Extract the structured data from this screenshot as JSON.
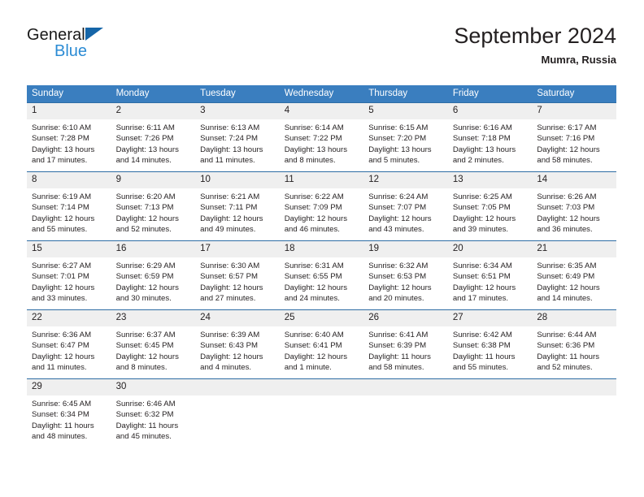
{
  "brand": {
    "name_part1": "General",
    "name_part2": "Blue",
    "triangle_icon": "triangle-icon",
    "accent_blue": "#2b8bd4",
    "logo_triangle_color": "#1565a8"
  },
  "header": {
    "title": "September 2024",
    "subtitle": "Mumra, Russia"
  },
  "theme": {
    "header_row_bg": "#3a7ebf",
    "row_rule": "#2e6da4",
    "daynum_bg": "#efefef",
    "text": "#231f20"
  },
  "calendar": {
    "weekday_headers": [
      "Sunday",
      "Monday",
      "Tuesday",
      "Wednesday",
      "Thursday",
      "Friday",
      "Saturday"
    ],
    "labels": {
      "sunrise": "Sunrise:",
      "sunset": "Sunset:",
      "daylight": "Daylight:"
    },
    "weeks": [
      [
        {
          "day": "1",
          "sunrise": "Sunrise: 6:10 AM",
          "sunset": "Sunset: 7:28 PM",
          "daylight_l1": "Daylight: 13 hours",
          "daylight_l2": "and 17 minutes."
        },
        {
          "day": "2",
          "sunrise": "Sunrise: 6:11 AM",
          "sunset": "Sunset: 7:26 PM",
          "daylight_l1": "Daylight: 13 hours",
          "daylight_l2": "and 14 minutes."
        },
        {
          "day": "3",
          "sunrise": "Sunrise: 6:13 AM",
          "sunset": "Sunset: 7:24 PM",
          "daylight_l1": "Daylight: 13 hours",
          "daylight_l2": "and 11 minutes."
        },
        {
          "day": "4",
          "sunrise": "Sunrise: 6:14 AM",
          "sunset": "Sunset: 7:22 PM",
          "daylight_l1": "Daylight: 13 hours",
          "daylight_l2": "and 8 minutes."
        },
        {
          "day": "5",
          "sunrise": "Sunrise: 6:15 AM",
          "sunset": "Sunset: 7:20 PM",
          "daylight_l1": "Daylight: 13 hours",
          "daylight_l2": "and 5 minutes."
        },
        {
          "day": "6",
          "sunrise": "Sunrise: 6:16 AM",
          "sunset": "Sunset: 7:18 PM",
          "daylight_l1": "Daylight: 13 hours",
          "daylight_l2": "and 2 minutes."
        },
        {
          "day": "7",
          "sunrise": "Sunrise: 6:17 AM",
          "sunset": "Sunset: 7:16 PM",
          "daylight_l1": "Daylight: 12 hours",
          "daylight_l2": "and 58 minutes."
        }
      ],
      [
        {
          "day": "8",
          "sunrise": "Sunrise: 6:19 AM",
          "sunset": "Sunset: 7:14 PM",
          "daylight_l1": "Daylight: 12 hours",
          "daylight_l2": "and 55 minutes."
        },
        {
          "day": "9",
          "sunrise": "Sunrise: 6:20 AM",
          "sunset": "Sunset: 7:13 PM",
          "daylight_l1": "Daylight: 12 hours",
          "daylight_l2": "and 52 minutes."
        },
        {
          "day": "10",
          "sunrise": "Sunrise: 6:21 AM",
          "sunset": "Sunset: 7:11 PM",
          "daylight_l1": "Daylight: 12 hours",
          "daylight_l2": "and 49 minutes."
        },
        {
          "day": "11",
          "sunrise": "Sunrise: 6:22 AM",
          "sunset": "Sunset: 7:09 PM",
          "daylight_l1": "Daylight: 12 hours",
          "daylight_l2": "and 46 minutes."
        },
        {
          "day": "12",
          "sunrise": "Sunrise: 6:24 AM",
          "sunset": "Sunset: 7:07 PM",
          "daylight_l1": "Daylight: 12 hours",
          "daylight_l2": "and 43 minutes."
        },
        {
          "day": "13",
          "sunrise": "Sunrise: 6:25 AM",
          "sunset": "Sunset: 7:05 PM",
          "daylight_l1": "Daylight: 12 hours",
          "daylight_l2": "and 39 minutes."
        },
        {
          "day": "14",
          "sunrise": "Sunrise: 6:26 AM",
          "sunset": "Sunset: 7:03 PM",
          "daylight_l1": "Daylight: 12 hours",
          "daylight_l2": "and 36 minutes."
        }
      ],
      [
        {
          "day": "15",
          "sunrise": "Sunrise: 6:27 AM",
          "sunset": "Sunset: 7:01 PM",
          "daylight_l1": "Daylight: 12 hours",
          "daylight_l2": "and 33 minutes."
        },
        {
          "day": "16",
          "sunrise": "Sunrise: 6:29 AM",
          "sunset": "Sunset: 6:59 PM",
          "daylight_l1": "Daylight: 12 hours",
          "daylight_l2": "and 30 minutes."
        },
        {
          "day": "17",
          "sunrise": "Sunrise: 6:30 AM",
          "sunset": "Sunset: 6:57 PM",
          "daylight_l1": "Daylight: 12 hours",
          "daylight_l2": "and 27 minutes."
        },
        {
          "day": "18",
          "sunrise": "Sunrise: 6:31 AM",
          "sunset": "Sunset: 6:55 PM",
          "daylight_l1": "Daylight: 12 hours",
          "daylight_l2": "and 24 minutes."
        },
        {
          "day": "19",
          "sunrise": "Sunrise: 6:32 AM",
          "sunset": "Sunset: 6:53 PM",
          "daylight_l1": "Daylight: 12 hours",
          "daylight_l2": "and 20 minutes."
        },
        {
          "day": "20",
          "sunrise": "Sunrise: 6:34 AM",
          "sunset": "Sunset: 6:51 PM",
          "daylight_l1": "Daylight: 12 hours",
          "daylight_l2": "and 17 minutes."
        },
        {
          "day": "21",
          "sunrise": "Sunrise: 6:35 AM",
          "sunset": "Sunset: 6:49 PM",
          "daylight_l1": "Daylight: 12 hours",
          "daylight_l2": "and 14 minutes."
        }
      ],
      [
        {
          "day": "22",
          "sunrise": "Sunrise: 6:36 AM",
          "sunset": "Sunset: 6:47 PM",
          "daylight_l1": "Daylight: 12 hours",
          "daylight_l2": "and 11 minutes."
        },
        {
          "day": "23",
          "sunrise": "Sunrise: 6:37 AM",
          "sunset": "Sunset: 6:45 PM",
          "daylight_l1": "Daylight: 12 hours",
          "daylight_l2": "and 8 minutes."
        },
        {
          "day": "24",
          "sunrise": "Sunrise: 6:39 AM",
          "sunset": "Sunset: 6:43 PM",
          "daylight_l1": "Daylight: 12 hours",
          "daylight_l2": "and 4 minutes."
        },
        {
          "day": "25",
          "sunrise": "Sunrise: 6:40 AM",
          "sunset": "Sunset: 6:41 PM",
          "daylight_l1": "Daylight: 12 hours",
          "daylight_l2": "and 1 minute."
        },
        {
          "day": "26",
          "sunrise": "Sunrise: 6:41 AM",
          "sunset": "Sunset: 6:39 PM",
          "daylight_l1": "Daylight: 11 hours",
          "daylight_l2": "and 58 minutes."
        },
        {
          "day": "27",
          "sunrise": "Sunrise: 6:42 AM",
          "sunset": "Sunset: 6:38 PM",
          "daylight_l1": "Daylight: 11 hours",
          "daylight_l2": "and 55 minutes."
        },
        {
          "day": "28",
          "sunrise": "Sunrise: 6:44 AM",
          "sunset": "Sunset: 6:36 PM",
          "daylight_l1": "Daylight: 11 hours",
          "daylight_l2": "and 52 minutes."
        }
      ],
      [
        {
          "day": "29",
          "sunrise": "Sunrise: 6:45 AM",
          "sunset": "Sunset: 6:34 PM",
          "daylight_l1": "Daylight: 11 hours",
          "daylight_l2": "and 48 minutes."
        },
        {
          "day": "30",
          "sunrise": "Sunrise: 6:46 AM",
          "sunset": "Sunset: 6:32 PM",
          "daylight_l1": "Daylight: 11 hours",
          "daylight_l2": "and 45 minutes."
        },
        {
          "day": "",
          "sunrise": "",
          "sunset": "",
          "daylight_l1": "",
          "daylight_l2": ""
        },
        {
          "day": "",
          "sunrise": "",
          "sunset": "",
          "daylight_l1": "",
          "daylight_l2": ""
        },
        {
          "day": "",
          "sunrise": "",
          "sunset": "",
          "daylight_l1": "",
          "daylight_l2": ""
        },
        {
          "day": "",
          "sunrise": "",
          "sunset": "",
          "daylight_l1": "",
          "daylight_l2": ""
        },
        {
          "day": "",
          "sunrise": "",
          "sunset": "",
          "daylight_l1": "",
          "daylight_l2": ""
        }
      ]
    ]
  }
}
